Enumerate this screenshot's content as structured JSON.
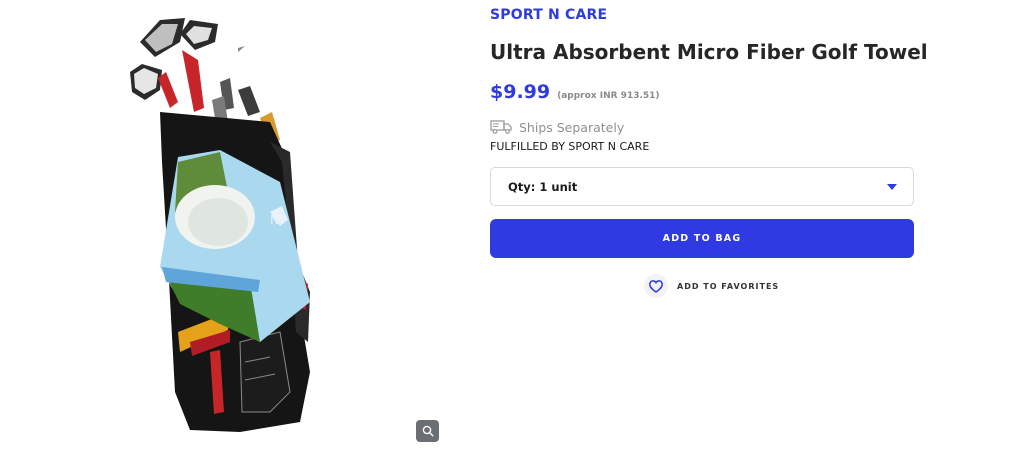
{
  "product": {
    "brand": "SPORT N CARE",
    "title": "Ultra Absorbent Micro Fiber Golf Towel",
    "price": "$9.99",
    "price_approx": "(approx INR 913.51)",
    "image_alt": "Golf bag with clubs and towel"
  },
  "shipping": {
    "ships_text": "Ships Separately",
    "fulfilled_text": "FULFILLED BY SPORT N CARE"
  },
  "quantity": {
    "selected": "Qty: 1 unit"
  },
  "actions": {
    "add_to_bag": "ADD TO BAG",
    "add_to_favorites": "ADD TO FAVORITES"
  },
  "colors": {
    "accent": "#2e3be0",
    "muted": "#8f8f8f"
  },
  "icons": {
    "zoom": "magnifier-icon",
    "truck": "truck-icon",
    "dropdown": "chevron-down-icon",
    "favorite": "heart-icon"
  }
}
